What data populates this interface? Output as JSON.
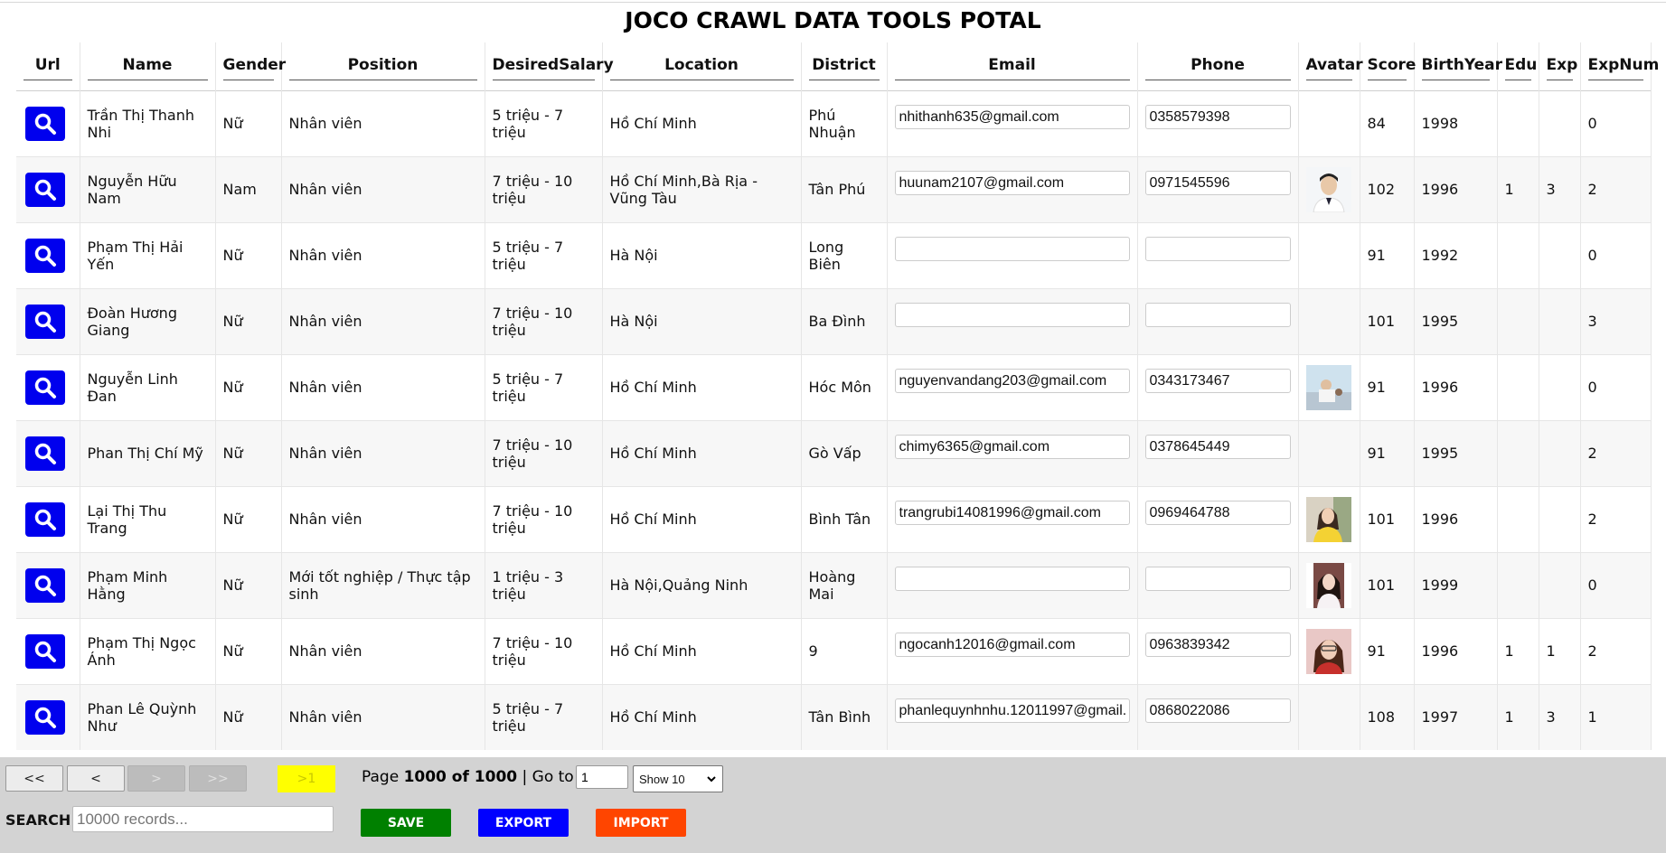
{
  "title": "JOCO CRAWL DATA TOOLS POTAL",
  "columns": [
    "Url",
    "Name",
    "Gender",
    "Position",
    "DesiredSalary",
    "Location",
    "District",
    "Email",
    "Phone",
    "Avatar",
    "Score",
    "BirthYear",
    "Edu",
    "Exp",
    "ExpNum"
  ],
  "rows": [
    {
      "name": "Trần Thị Thanh Nhi",
      "gender": "Nữ",
      "position": "Nhân viên",
      "salary": "5 triệu - 7 triệu",
      "location": "Hồ Chí Minh",
      "district": "Phú Nhuận",
      "email": "nhithanh635@gmail.com",
      "phone": "0358579398",
      "avatar": "",
      "score": "84",
      "birth": "1998",
      "edu": "",
      "exp": "",
      "expnum": "0"
    },
    {
      "name": "Nguyễn Hữu Nam",
      "gender": "Nam",
      "position": "Nhân viên",
      "salary": "7 triệu - 10 triệu",
      "location": "Hồ Chí Minh,Bà Rịa - Vũng Tàu",
      "district": "Tân Phú",
      "email": "huunam2107@gmail.com",
      "phone": "0971545596",
      "avatar": "photo",
      "score": "102",
      "birth": "1996",
      "edu": "1",
      "exp": "3",
      "expnum": "2"
    },
    {
      "name": "Phạm Thị Hải Yến",
      "gender": "Nữ",
      "position": "Nhân viên",
      "salary": "5 triệu - 7 triệu",
      "location": "Hà Nội",
      "district": "Long Biên",
      "email": "",
      "phone": "",
      "avatar": "",
      "score": "91",
      "birth": "1992",
      "edu": "",
      "exp": "",
      "expnum": "0"
    },
    {
      "name": "Đoàn Hương Giang",
      "gender": "Nữ",
      "position": "Nhân viên",
      "salary": "7 triệu - 10 triệu",
      "location": "Hà Nội",
      "district": "Ba Đình",
      "email": "",
      "phone": "",
      "avatar": "",
      "score": "101",
      "birth": "1995",
      "edu": "",
      "exp": "",
      "expnum": "3"
    },
    {
      "name": "Nguyễn Linh Đan",
      "gender": "Nữ",
      "position": "Nhân viên",
      "salary": "5 triệu - 7 triệu",
      "location": "Hồ Chí Minh",
      "district": "Hóc Môn",
      "email": "nguyenvandang203@gmail.com",
      "phone": "0343173467",
      "avatar": "photo",
      "score": "91",
      "birth": "1996",
      "edu": "",
      "exp": "",
      "expnum": "0"
    },
    {
      "name": "Phan Thị Chí Mỹ",
      "gender": "Nữ",
      "position": "Nhân viên",
      "salary": "7 triệu - 10 triệu",
      "location": "Hồ Chí Minh",
      "district": "Gò Vấp",
      "email": "chimy6365@gmail.com",
      "phone": "0378645449",
      "avatar": "",
      "score": "91",
      "birth": "1995",
      "edu": "",
      "exp": "",
      "expnum": "2"
    },
    {
      "name": "Lại Thị Thu Trang",
      "gender": "Nữ",
      "position": "Nhân viên",
      "salary": "7 triệu - 10 triệu",
      "location": "Hồ Chí Minh",
      "district": "Bình Tân",
      "email": "trangrubi14081996@gmail.com",
      "phone": "0969464788",
      "avatar": "photo",
      "score": "101",
      "birth": "1996",
      "edu": "",
      "exp": "",
      "expnum": "2"
    },
    {
      "name": "Phạm Minh Hằng",
      "gender": "Nữ",
      "position": "Mới tốt nghiệp / Thực tập sinh",
      "salary": "1 triệu - 3 triệu",
      "location": "Hà Nội,Quảng Ninh",
      "district": "Hoàng Mai",
      "email": "",
      "phone": "",
      "avatar": "photo",
      "score": "101",
      "birth": "1999",
      "edu": "",
      "exp": "",
      "expnum": "0"
    },
    {
      "name": "Phạm Thị Ngọc Ánh",
      "gender": "Nữ",
      "position": "Nhân viên",
      "salary": "7 triệu - 10 triệu",
      "location": "Hồ Chí Minh",
      "district": "9",
      "email": "ngocanh12016@gmail.com",
      "phone": "0963839342",
      "avatar": "photo",
      "score": "91",
      "birth": "1996",
      "edu": "1",
      "exp": "1",
      "expnum": "2"
    },
    {
      "name": "Phan Lê Quỳnh Như",
      "gender": "Nữ",
      "position": "Nhân viên",
      "salary": "5 triệu - 7 triệu",
      "location": "Hồ Chí Minh",
      "district": "Tân Bình",
      "email": "phanlequynhnhu.12011997@gmail.",
      "phone": "0868022086",
      "avatar": "",
      "score": "108",
      "birth": "1997",
      "edu": "1",
      "exp": "3",
      "expnum": "1"
    }
  ],
  "pagination": {
    "first_label": "<<",
    "prev_label": "<",
    "next_label": ">",
    "last_label": ">>",
    "current_label": ">1",
    "page_prefix": "Page",
    "page_current": "1000 of 1000",
    "goto_label": "| Go to page:",
    "goto_value": "1",
    "show_selected": "Show 10"
  },
  "search": {
    "label": "SEARCH :",
    "placeholder": "10000 records..."
  },
  "actions": {
    "save_label": "SAVE",
    "export_label": "EXPORT",
    "import_label": "IMPORT"
  },
  "colors": {
    "url_button": "#0000ee",
    "save": "#008000",
    "export": "#0000ff",
    "import": "#ff4500",
    "current_page": "#ffff00",
    "footer": "#d3d3d3"
  },
  "icons": {
    "url": "search-icon",
    "show_select": "chevron-down-icon"
  }
}
